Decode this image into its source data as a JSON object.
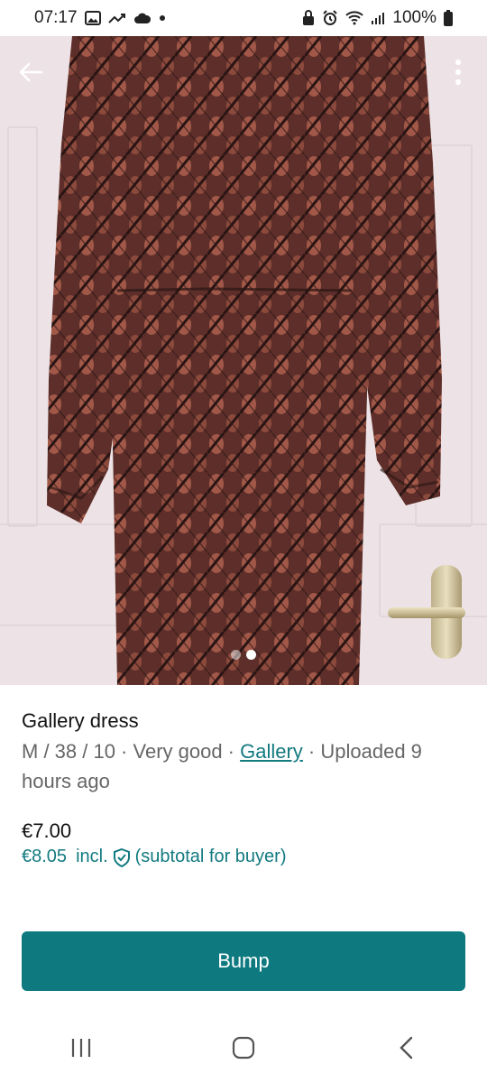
{
  "status_bar": {
    "time": "07:17",
    "battery": "100%",
    "left_icons": [
      "gallery-icon",
      "trending-icon",
      "cloud-icon",
      "dot-icon"
    ],
    "right_icons": [
      "lock-icon",
      "alarm-icon",
      "wifi-icon",
      "signal-icon",
      "battery-icon"
    ]
  },
  "photo": {
    "page_count": 2,
    "active_page": 2
  },
  "item": {
    "title": "Gallery dress",
    "meta_prefix": "M / 38 / 10 · Very good · ",
    "brand": "Gallery",
    "meta_suffix": " · Uploaded 9 hours ago",
    "price": "€7.00",
    "buyer_price": "€8.05",
    "buyer_incl": "incl.",
    "buyer_note": "(subtotal for buyer)"
  },
  "actions": {
    "bump_label": "Bump"
  },
  "colors": {
    "accent": "#0e7a80",
    "link": "#137a80"
  }
}
